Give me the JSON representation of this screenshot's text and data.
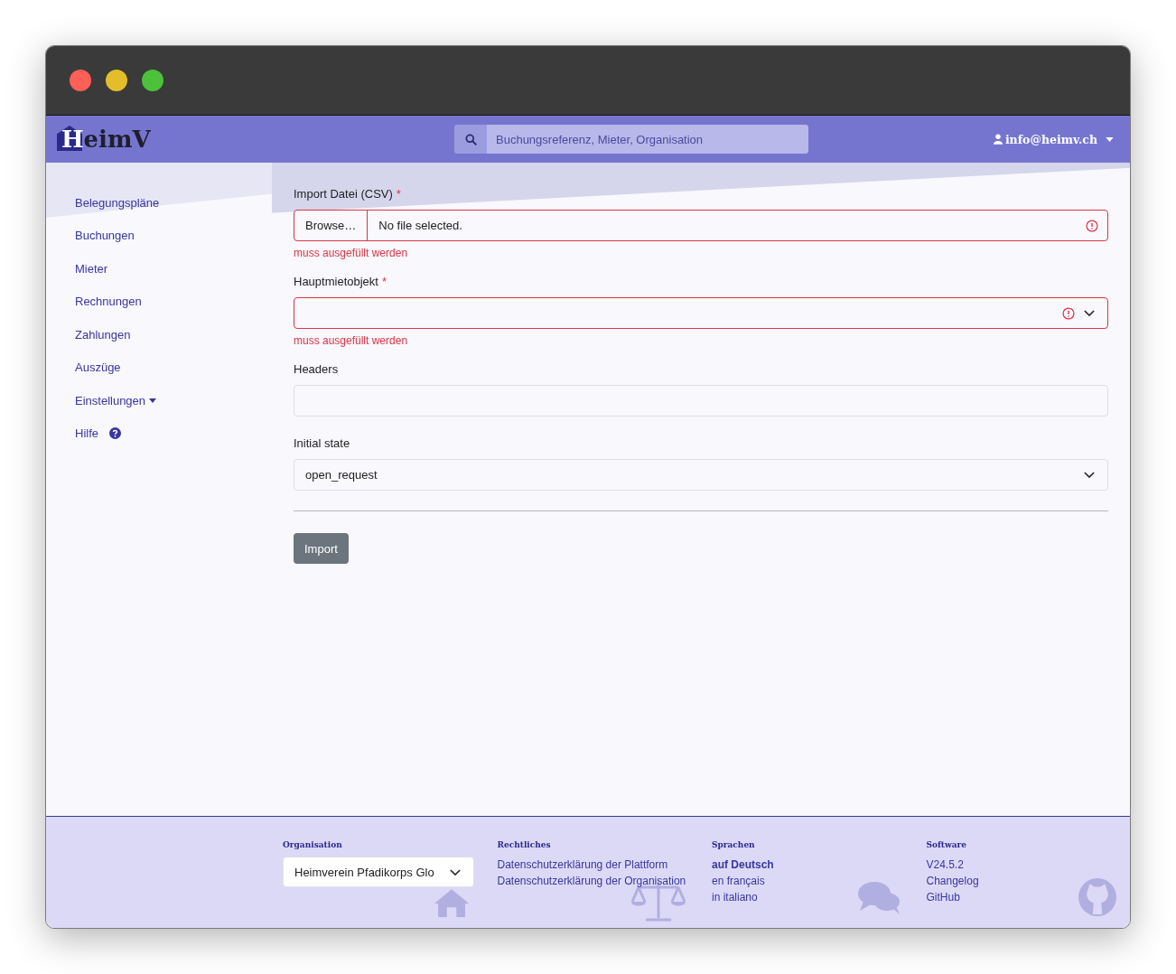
{
  "navbar": {
    "logo": {
      "first": "H",
      "rest": "eimV"
    },
    "search": {
      "placeholder": "Buchungsreferenz, Mieter, Organisation"
    },
    "user": "info@heimv.ch"
  },
  "sidebar": {
    "items": [
      {
        "label": "Belegungspläne",
        "kind": "link"
      },
      {
        "label": "Buchungen",
        "kind": "link"
      },
      {
        "label": "Mieter",
        "kind": "link"
      },
      {
        "label": "Rechnungen",
        "kind": "link"
      },
      {
        "label": "Zahlungen",
        "kind": "link"
      },
      {
        "label": "Auszüge",
        "kind": "link"
      },
      {
        "label": "Einstellungen",
        "kind": "dropdown"
      },
      {
        "label": "Hilfe",
        "kind": "help"
      }
    ]
  },
  "form": {
    "fields": [
      {
        "kind": "file",
        "label": "Import Datei (CSV)",
        "required_mark": "*",
        "invalid": true,
        "button": "Browse…",
        "value": "No file selected.",
        "error": "muss ausgefüllt werden"
      },
      {
        "kind": "select",
        "label": "Hauptmietobjekt",
        "required_mark": "*",
        "invalid": true,
        "error": "muss ausgefüllt werden"
      },
      {
        "kind": "text",
        "label": "Headers",
        "invalid": false
      },
      {
        "kind": "select",
        "label": "Initial state",
        "invalid": false,
        "value": "open_request"
      }
    ],
    "submit": "Import"
  },
  "footer": {
    "columns": [
      {
        "kind": "select",
        "heading": "Organisation",
        "value": "Heimverein Pfadikorps Glo"
      },
      {
        "kind": "links",
        "heading": "Rechtliches",
        "links": [
          {
            "label": "Datenschutzerklärung der Plattform",
            "selected": false
          },
          {
            "label": "Datenschutzerklärung der Organisation",
            "selected": false
          }
        ]
      },
      {
        "kind": "links",
        "heading": "Sprachen",
        "links": [
          {
            "label": "auf Deutsch",
            "selected": true
          },
          {
            "label": "en français",
            "selected": false
          },
          {
            "label": "in italiano",
            "selected": false
          }
        ]
      },
      {
        "kind": "links",
        "heading": "Software",
        "links": [
          {
            "label": "V24.5.2",
            "selected": false
          },
          {
            "label": "Changelog",
            "selected": false
          },
          {
            "label": "GitHub",
            "selected": false
          }
        ]
      }
    ]
  }
}
